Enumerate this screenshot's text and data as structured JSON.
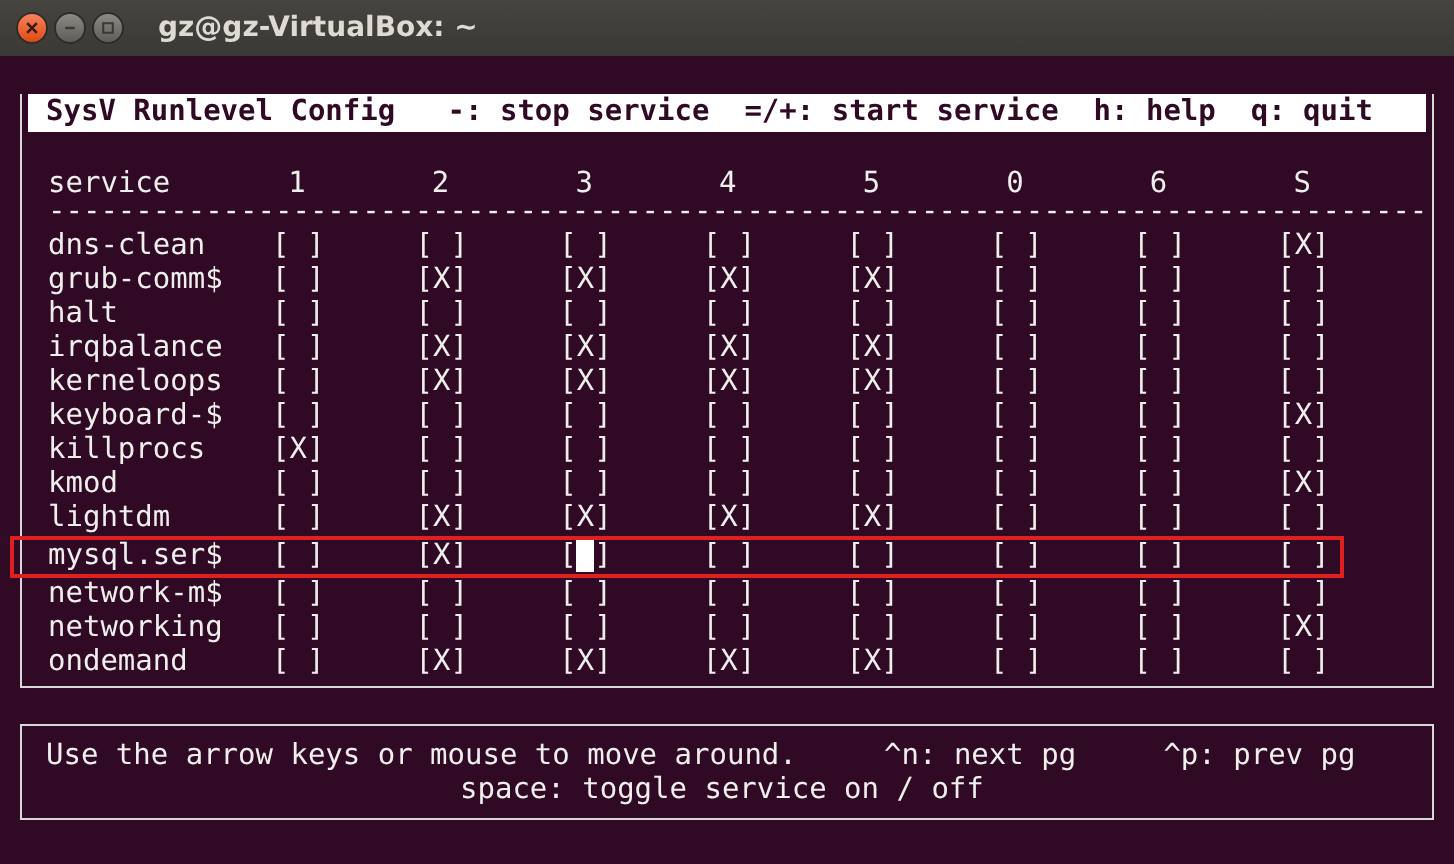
{
  "window": {
    "title": "gz@gz-VirtualBox: ~"
  },
  "header_bar": "SysV Runlevel Config   -: stop service  =/+: start service  h: help  q: quit",
  "table": {
    "service_heading": "service",
    "runlevels": [
      "1",
      "2",
      "3",
      "4",
      "5",
      "0",
      "6",
      "S"
    ],
    "separator": "-------------------------------------------------------------------------------",
    "rows": [
      {
        "name": "dns-clean",
        "selected": false,
        "cells": [
          {
            "text": "[ ]",
            "cursor": false
          },
          {
            "text": "[ ]",
            "cursor": false
          },
          {
            "text": "[ ]",
            "cursor": false
          },
          {
            "text": "[ ]",
            "cursor": false
          },
          {
            "text": "[ ]",
            "cursor": false
          },
          {
            "text": "[ ]",
            "cursor": false
          },
          {
            "text": "[ ]",
            "cursor": false
          },
          {
            "text": "[X]",
            "cursor": false
          }
        ]
      },
      {
        "name": "grub-comm$",
        "selected": false,
        "cells": [
          {
            "text": "[ ]",
            "cursor": false
          },
          {
            "text": "[X]",
            "cursor": false
          },
          {
            "text": "[X]",
            "cursor": false
          },
          {
            "text": "[X]",
            "cursor": false
          },
          {
            "text": "[X]",
            "cursor": false
          },
          {
            "text": "[ ]",
            "cursor": false
          },
          {
            "text": "[ ]",
            "cursor": false
          },
          {
            "text": "[ ]",
            "cursor": false
          }
        ]
      },
      {
        "name": "halt",
        "selected": false,
        "cells": [
          {
            "text": "[ ]",
            "cursor": false
          },
          {
            "text": "[ ]",
            "cursor": false
          },
          {
            "text": "[ ]",
            "cursor": false
          },
          {
            "text": "[ ]",
            "cursor": false
          },
          {
            "text": "[ ]",
            "cursor": false
          },
          {
            "text": "[ ]",
            "cursor": false
          },
          {
            "text": "[ ]",
            "cursor": false
          },
          {
            "text": "[ ]",
            "cursor": false
          }
        ]
      },
      {
        "name": "irqbalance",
        "selected": false,
        "cells": [
          {
            "text": "[ ]",
            "cursor": false
          },
          {
            "text": "[X]",
            "cursor": false
          },
          {
            "text": "[X]",
            "cursor": false
          },
          {
            "text": "[X]",
            "cursor": false
          },
          {
            "text": "[X]",
            "cursor": false
          },
          {
            "text": "[ ]",
            "cursor": false
          },
          {
            "text": "[ ]",
            "cursor": false
          },
          {
            "text": "[ ]",
            "cursor": false
          }
        ]
      },
      {
        "name": "kerneloops",
        "selected": false,
        "cells": [
          {
            "text": "[ ]",
            "cursor": false
          },
          {
            "text": "[X]",
            "cursor": false
          },
          {
            "text": "[X]",
            "cursor": false
          },
          {
            "text": "[X]",
            "cursor": false
          },
          {
            "text": "[X]",
            "cursor": false
          },
          {
            "text": "[ ]",
            "cursor": false
          },
          {
            "text": "[ ]",
            "cursor": false
          },
          {
            "text": "[ ]",
            "cursor": false
          }
        ]
      },
      {
        "name": "keyboard-$",
        "selected": false,
        "cells": [
          {
            "text": "[ ]",
            "cursor": false
          },
          {
            "text": "[ ]",
            "cursor": false
          },
          {
            "text": "[ ]",
            "cursor": false
          },
          {
            "text": "[ ]",
            "cursor": false
          },
          {
            "text": "[ ]",
            "cursor": false
          },
          {
            "text": "[ ]",
            "cursor": false
          },
          {
            "text": "[ ]",
            "cursor": false
          },
          {
            "text": "[X]",
            "cursor": false
          }
        ]
      },
      {
        "name": "killprocs",
        "selected": false,
        "cells": [
          {
            "text": "[X]",
            "cursor": false
          },
          {
            "text": "[ ]",
            "cursor": false
          },
          {
            "text": "[ ]",
            "cursor": false
          },
          {
            "text": "[ ]",
            "cursor": false
          },
          {
            "text": "[ ]",
            "cursor": false
          },
          {
            "text": "[ ]",
            "cursor": false
          },
          {
            "text": "[ ]",
            "cursor": false
          },
          {
            "text": "[ ]",
            "cursor": false
          }
        ]
      },
      {
        "name": "kmod",
        "selected": false,
        "cells": [
          {
            "text": "[ ]",
            "cursor": false
          },
          {
            "text": "[ ]",
            "cursor": false
          },
          {
            "text": "[ ]",
            "cursor": false
          },
          {
            "text": "[ ]",
            "cursor": false
          },
          {
            "text": "[ ]",
            "cursor": false
          },
          {
            "text": "[ ]",
            "cursor": false
          },
          {
            "text": "[ ]",
            "cursor": false
          },
          {
            "text": "[X]",
            "cursor": false
          }
        ]
      },
      {
        "name": "lightdm",
        "selected": false,
        "cells": [
          {
            "text": "[ ]",
            "cursor": false
          },
          {
            "text": "[X]",
            "cursor": false
          },
          {
            "text": "[X]",
            "cursor": false
          },
          {
            "text": "[X]",
            "cursor": false
          },
          {
            "text": "[X]",
            "cursor": false
          },
          {
            "text": "[ ]",
            "cursor": false
          },
          {
            "text": "[ ]",
            "cursor": false
          },
          {
            "text": "[ ]",
            "cursor": false
          }
        ]
      },
      {
        "name": "mysql.ser$",
        "selected": true,
        "cells": [
          {
            "text": "[ ]",
            "cursor": false
          },
          {
            "text": "[X]",
            "cursor": false
          },
          {
            "text": "[ ]",
            "cursor": true
          },
          {
            "text": "[ ]",
            "cursor": false
          },
          {
            "text": "[ ]",
            "cursor": false
          },
          {
            "text": "[ ]",
            "cursor": false
          },
          {
            "text": "[ ]",
            "cursor": false
          },
          {
            "text": "[ ]",
            "cursor": false
          }
        ]
      },
      {
        "name": "network-m$",
        "selected": false,
        "cells": [
          {
            "text": "[ ]",
            "cursor": false
          },
          {
            "text": "[ ]",
            "cursor": false
          },
          {
            "text": "[ ]",
            "cursor": false
          },
          {
            "text": "[ ]",
            "cursor": false
          },
          {
            "text": "[ ]",
            "cursor": false
          },
          {
            "text": "[ ]",
            "cursor": false
          },
          {
            "text": "[ ]",
            "cursor": false
          },
          {
            "text": "[ ]",
            "cursor": false
          }
        ]
      },
      {
        "name": "networking",
        "selected": false,
        "cells": [
          {
            "text": "[ ]",
            "cursor": false
          },
          {
            "text": "[ ]",
            "cursor": false
          },
          {
            "text": "[ ]",
            "cursor": false
          },
          {
            "text": "[ ]",
            "cursor": false
          },
          {
            "text": "[ ]",
            "cursor": false
          },
          {
            "text": "[ ]",
            "cursor": false
          },
          {
            "text": "[ ]",
            "cursor": false
          },
          {
            "text": "[X]",
            "cursor": false
          }
        ]
      },
      {
        "name": "ondemand",
        "selected": false,
        "cells": [
          {
            "text": "[ ]",
            "cursor": false
          },
          {
            "text": "[X]",
            "cursor": false
          },
          {
            "text": "[X]",
            "cursor": false
          },
          {
            "text": "[X]",
            "cursor": false
          },
          {
            "text": "[X]",
            "cursor": false
          },
          {
            "text": "[ ]",
            "cursor": false
          },
          {
            "text": "[ ]",
            "cursor": false
          },
          {
            "text": "[ ]",
            "cursor": false
          }
        ]
      }
    ]
  },
  "help": {
    "line_1": "Use the arrow keys or mouse to move around.     ^n: next pg     ^p: prev pg",
    "line_2": "space: toggle service on / off"
  }
}
